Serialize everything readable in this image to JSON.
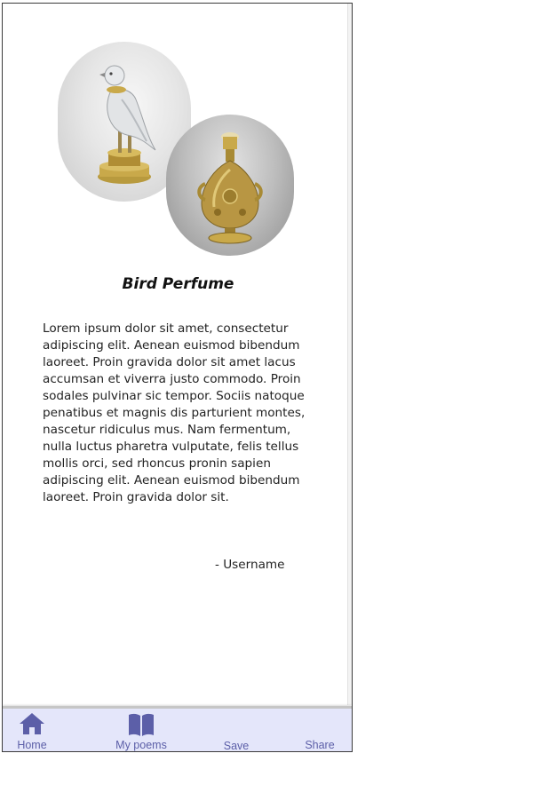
{
  "poem": {
    "title": "Bird Perfume",
    "body": "Lorem ipsum dolor sit amet, consectetur adipiscing elit. Aenean euismod bibendum laoreet. Proin gravida dolor sit amet lacus accumsan et viverra justo commodo. Proin sodales pulvinar sic tempor. Sociis natoque penatibus et magnis dis parturient montes, nascetur ridiculus mus. Nam fermentum, nulla luctus pharetra vulputate, felis tellus mollis orci, sed rhoncus pronin sapien adipiscing elit. Aenean euismod bibendum laoreet. Proin gravida dolor sit.",
    "author": "- Username"
  },
  "images": [
    {
      "subject": "bird-figurine"
    },
    {
      "subject": "gilded-perfume-flask"
    }
  ],
  "nav": {
    "items": [
      {
        "label": "Home",
        "icon": "home-icon"
      },
      {
        "label": "My poems",
        "icon": "book-icon"
      },
      {
        "label": "Save",
        "icon": ""
      },
      {
        "label": "Share",
        "icon": ""
      }
    ]
  },
  "colors": {
    "nav_background": "#e4e6fa",
    "nav_accent": "#5c5fa8"
  }
}
